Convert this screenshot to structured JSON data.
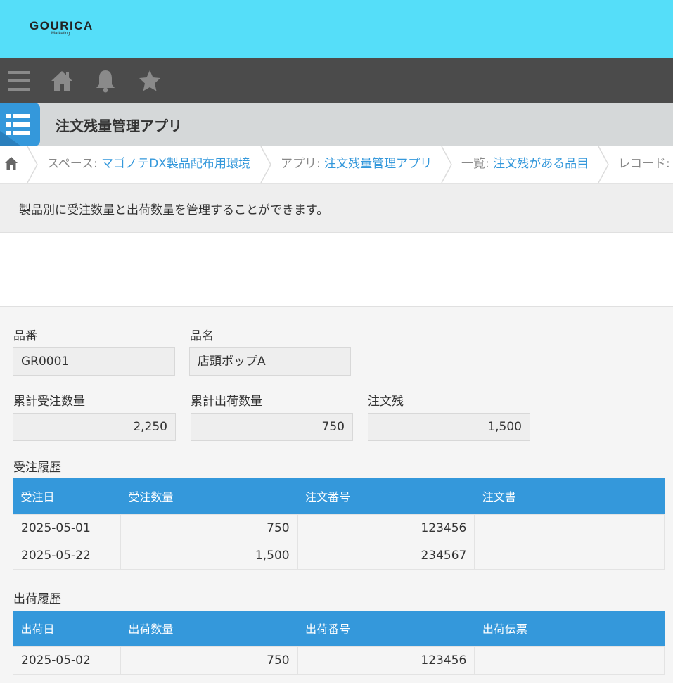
{
  "brand": {
    "logo": "GOURICA",
    "logo_sub": "Marketing",
    "header_color": "#55def9"
  },
  "nav": {
    "icons": [
      "menu-icon",
      "home-icon",
      "bell-icon",
      "star-icon"
    ]
  },
  "app": {
    "title": "注文残量管理アプリ"
  },
  "breadcrumb": {
    "space_prefix": "スペース: ",
    "space": "マゴノテDX製品配布用環境",
    "app_prefix": "アプリ: ",
    "app": "注文残量管理アプリ",
    "list_prefix": "一覧: ",
    "list": "注文残がある品目",
    "record_prefix": "レコード: "
  },
  "description": "製品別に受注数量と出荷数量を管理することができます。",
  "record": {
    "part_no_label": "品番",
    "part_no": "GR0001",
    "part_name_label": "品名",
    "part_name": "店頭ポップA",
    "total_order_label": "累計受注数量",
    "total_order": "2,250",
    "total_ship_label": "累計出荷数量",
    "total_ship": "750",
    "backlog_label": "注文残",
    "backlog": "1,500"
  },
  "order_history": {
    "title": "受注履歴",
    "headers": [
      "受注日",
      "受注数量",
      "注文番号",
      "注文書"
    ],
    "rows": [
      [
        "2025-05-01",
        "750",
        "123456",
        ""
      ],
      [
        "2025-05-22",
        "1,500",
        "234567",
        ""
      ]
    ]
  },
  "ship_history": {
    "title": "出荷履歴",
    "headers": [
      "出荷日",
      "出荷数量",
      "出荷番号",
      "出荷伝票"
    ],
    "rows": [
      [
        "2025-05-02",
        "750",
        "123456",
        ""
      ]
    ]
  },
  "colors": {
    "accent": "#3498db",
    "nav_bg": "#4b4b4b"
  }
}
